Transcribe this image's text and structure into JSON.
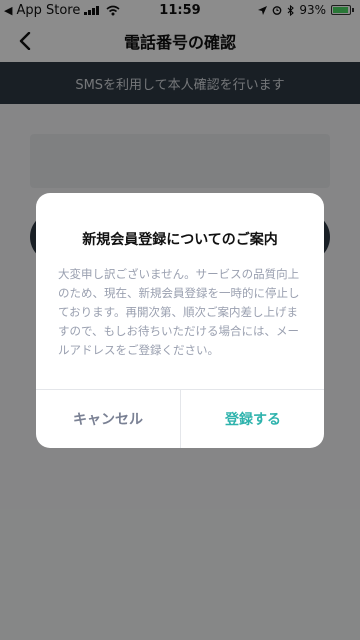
{
  "status_bar": {
    "back_label": "App Store",
    "time": "11:59",
    "battery": "93%",
    "battery_level": 0.93
  },
  "nav": {
    "title": "電話番号の確認"
  },
  "banner": {
    "text": "SMSを利用して本人確認を行います"
  },
  "dialog": {
    "title": "新規会員登録についてのご案内",
    "message": "大変申し訳ございません。サービスの品質向上のため、現在、新規会員登録を一時的に停止しております。再開次第、順次ご案内差し上げますので、もしお待ちいただける場合には、メールアドレスをご登録ください。",
    "cancel_label": "キャンセル",
    "register_label": "登録する"
  },
  "colors": {
    "banner_bg": "#2f3a44",
    "accent": "#2fb3ad",
    "cancel": "#7a8194"
  }
}
